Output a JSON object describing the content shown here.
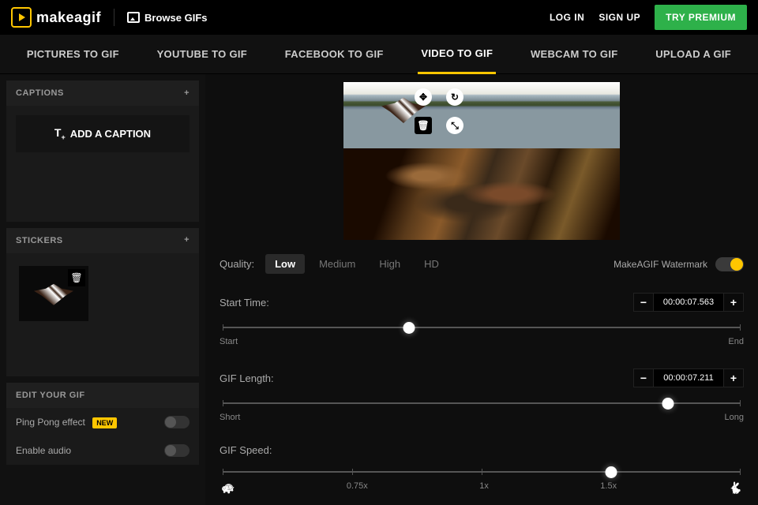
{
  "header": {
    "logo_text": "makeagif",
    "browse": "Browse GIFs",
    "login": "LOG IN",
    "signup": "SIGN UP",
    "premium": "TRY PREMIUM"
  },
  "tabs": [
    {
      "label": "PICTURES TO GIF",
      "active": false
    },
    {
      "label": "YOUTUBE TO GIF",
      "active": false
    },
    {
      "label": "FACEBOOK TO GIF",
      "active": false
    },
    {
      "label": "VIDEO TO GIF",
      "active": true
    },
    {
      "label": "WEBCAM TO GIF",
      "active": false
    },
    {
      "label": "UPLOAD A GIF",
      "active": false
    }
  ],
  "sidebar": {
    "captions_title": "CAPTIONS",
    "add_caption": "ADD A CAPTION",
    "stickers_title": "STICKERS",
    "edit_title": "EDIT YOUR GIF",
    "pingpong": "Ping Pong effect",
    "new_badge": "NEW",
    "enable_audio": "Enable audio"
  },
  "controls": {
    "quality_label": "Quality:",
    "quality_options": [
      "Low",
      "Medium",
      "High",
      "HD"
    ],
    "quality_active": "Low",
    "watermark_label": "MakeAGIF Watermark",
    "start_time_label": "Start Time:",
    "start_time_value": "00:00:07.563",
    "start_labels": [
      "Start",
      "End"
    ],
    "gif_length_label": "GIF Length:",
    "gif_length_value": "00:00:07.211",
    "length_labels": [
      "Short",
      "Long"
    ],
    "gif_speed_label": "GIF Speed:",
    "speed_labels": [
      "0.75x",
      "1x",
      "1.5x"
    ]
  },
  "icons": {
    "turtle": "🐢",
    "rabbit": "🐇",
    "trash": "🗑",
    "move": "✥",
    "rotate": "↻",
    "resize": "⤡",
    "text": "T"
  }
}
